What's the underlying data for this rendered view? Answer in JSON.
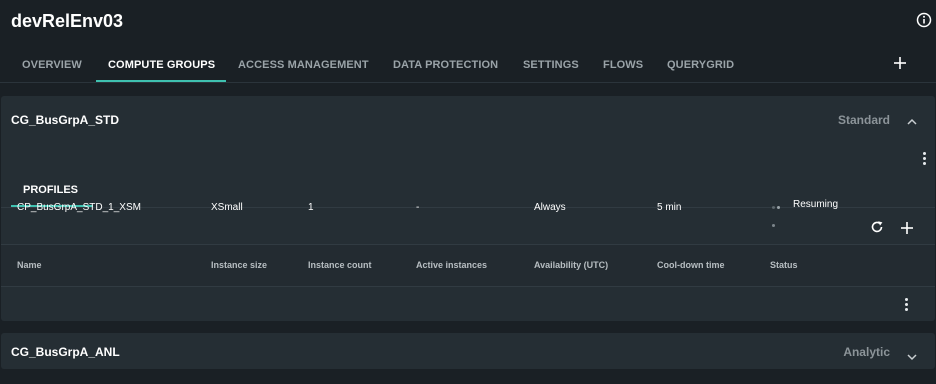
{
  "environment": {
    "title": "devRelEnv03",
    "tabs": [
      {
        "label": "OVERVIEW"
      },
      {
        "label": "COMPUTE GROUPS",
        "active": true
      },
      {
        "label": "ACCESS MANAGEMENT"
      },
      {
        "label": "DATA PROTECTION"
      },
      {
        "label": "SETTINGS"
      },
      {
        "label": "FLOWS"
      },
      {
        "label": "QUERYGRID"
      }
    ]
  },
  "compute_groups": [
    {
      "name": "CG_BusGrpA_STD",
      "type": "Standard",
      "expanded": true,
      "profiles_tab": "PROFILES",
      "table": {
        "headers": [
          "Name",
          "Instance size",
          "Instance count",
          "Active instances",
          "Availability (UTC)",
          "Cool-down time",
          "Status"
        ],
        "rows": [
          {
            "name": "CP_BusGrpA_STD_1_XSM",
            "instance_size": "XSmall",
            "instance_count": "1",
            "active_instances": "-",
            "availability": "Always",
            "cooldown": "5 min",
            "status": "Resuming"
          }
        ]
      }
    },
    {
      "name": "CG_BusGrpA_ANL",
      "type": "Analytic",
      "expanded": false
    }
  ],
  "colors": {
    "background": "#1a2025",
    "panel": "#252e34",
    "accent": "#3fc1b0",
    "muted_text": "#9aa3a8"
  },
  "icons": [
    "info-icon",
    "plus-icon",
    "chevron-up-icon",
    "chevron-down-icon",
    "kebab-menu-icon",
    "refresh-icon",
    "loading-dots-icon"
  ]
}
